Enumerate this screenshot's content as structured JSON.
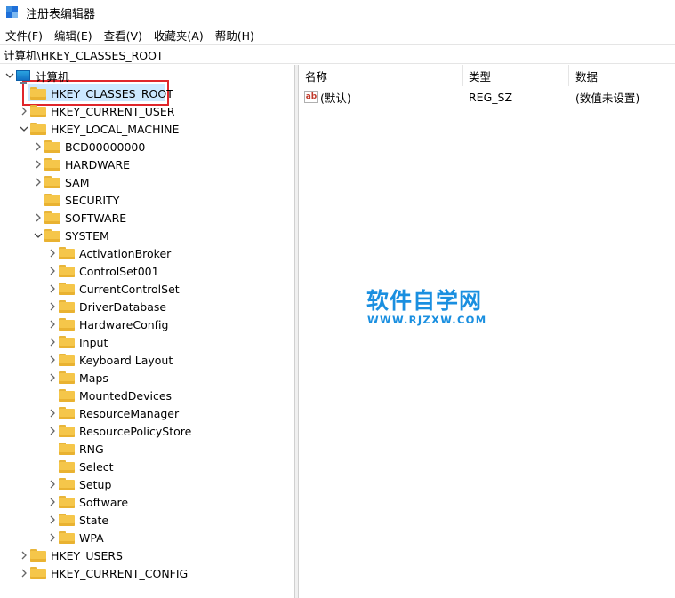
{
  "window": {
    "title": "注册表编辑器"
  },
  "menu": [
    "文件(F)",
    "编辑(E)",
    "查看(V)",
    "收藏夹(A)",
    "帮助(H)"
  ],
  "address": "计算机\\HKEY_CLASSES_ROOT",
  "tree": {
    "root": "计算机",
    "hkeys": {
      "classes_root": "HKEY_CLASSES_ROOT",
      "current_user": "HKEY_CURRENT_USER",
      "local_machine": "HKEY_LOCAL_MACHINE",
      "users": "HKEY_USERS",
      "current_config": "HKEY_CURRENT_CONFIG"
    },
    "local_machine_children": [
      "BCD00000000",
      "HARDWARE",
      "SAM",
      "SECURITY",
      "SOFTWARE",
      "SYSTEM"
    ],
    "system_children": [
      "ActivationBroker",
      "ControlSet001",
      "CurrentControlSet",
      "DriverDatabase",
      "HardwareConfig",
      "Input",
      "Keyboard Layout",
      "Maps",
      "MountedDevices",
      "ResourceManager",
      "ResourcePolicyStore",
      "RNG",
      "Select",
      "Setup",
      "Software",
      "State",
      "WPA"
    ]
  },
  "list": {
    "columns": {
      "name": "名称",
      "type": "类型",
      "data": "数据"
    },
    "rows": [
      {
        "icon": "ab",
        "name": "(默认)",
        "type": "REG_SZ",
        "data": "(数值未设置)"
      }
    ]
  },
  "watermark": {
    "title": "软件自学网",
    "url": "WWW.RJZXW.COM"
  }
}
